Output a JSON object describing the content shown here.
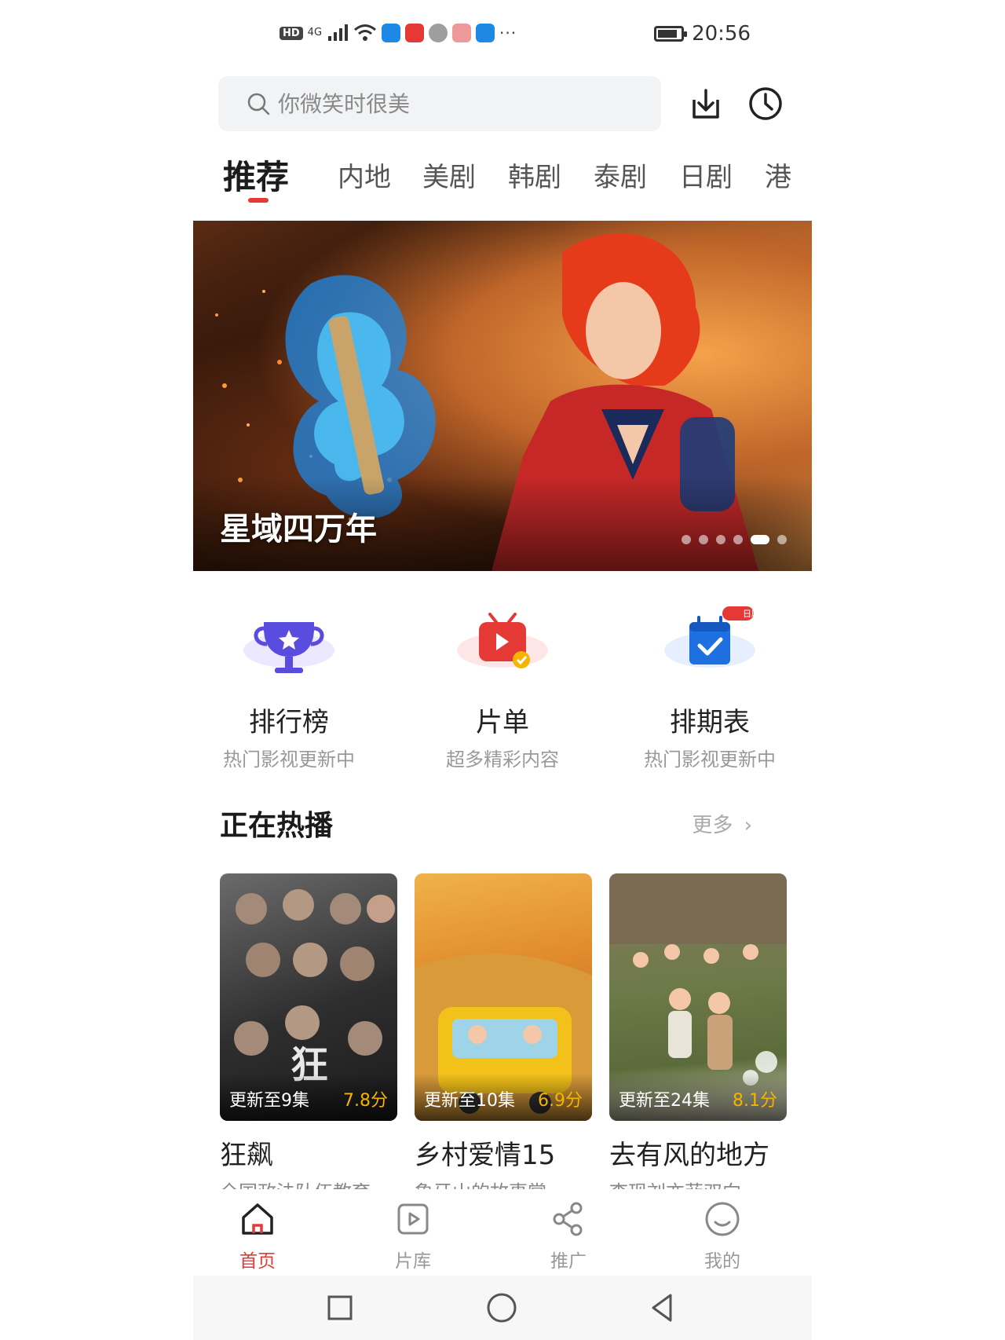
{
  "status_bar": {
    "hd": "HD",
    "network": "4G",
    "more": "···",
    "time": "20:56"
  },
  "search": {
    "placeholder": "你微笑时很美"
  },
  "tabs": [
    "推荐",
    "内地",
    "美剧",
    "韩剧",
    "泰剧",
    "日剧",
    "港"
  ],
  "banner": {
    "title": "星域四万年",
    "dot_count": 6,
    "active_dot": 4
  },
  "quick_links": [
    {
      "label": "排行榜",
      "sub": "热门影视更新中",
      "icon": "trophy-icon"
    },
    {
      "label": "片单",
      "sub": "超多精彩内容",
      "icon": "playlist-tv-icon"
    },
    {
      "label": "排期表",
      "sub": "热门影视更新中",
      "icon": "calendar-check-icon",
      "badge": "日剧"
    }
  ],
  "section": {
    "title": "正在热播",
    "more": "更多"
  },
  "cards": [
    {
      "ep": "更新至9集",
      "score": "7.8分",
      "title": "狂飙",
      "desc": "全国政法队伍教育"
    },
    {
      "ep": "更新至10集",
      "score": "6.9分",
      "title": "乡村爱情15",
      "desc": "象牙山的故事掌"
    },
    {
      "ep": "更新至24集",
      "score": "8.1分",
      "title": "去有风的地方",
      "desc": "李现刘亦菲双向"
    }
  ],
  "bottom_nav": [
    {
      "label": "首页",
      "icon": "home-icon"
    },
    {
      "label": "片库",
      "icon": "library-play-icon"
    },
    {
      "label": "推广",
      "icon": "share-icon"
    },
    {
      "label": "我的",
      "icon": "profile-smile-icon"
    }
  ],
  "colors": {
    "accent": "#e53935",
    "score": "#f4b400"
  }
}
